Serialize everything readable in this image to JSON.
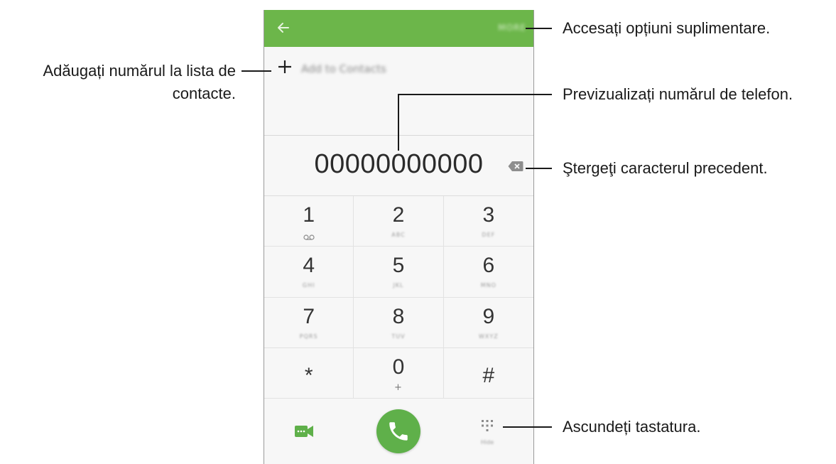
{
  "dialer": {
    "more_label": "MORE",
    "add_contact_label": "Add to Contacts",
    "phone_number": "00000000000",
    "keys": [
      {
        "digit": "1",
        "sub": ""
      },
      {
        "digit": "2",
        "sub": "ABC"
      },
      {
        "digit": "3",
        "sub": "DEF"
      },
      {
        "digit": "4",
        "sub": "GHI"
      },
      {
        "digit": "5",
        "sub": "JKL"
      },
      {
        "digit": "6",
        "sub": "MNO"
      },
      {
        "digit": "7",
        "sub": "PQRS"
      },
      {
        "digit": "8",
        "sub": "TUV"
      },
      {
        "digit": "9",
        "sub": "WXYZ"
      },
      {
        "digit": "*",
        "sub": ""
      },
      {
        "digit": "0",
        "sub": "+"
      },
      {
        "digit": "#",
        "sub": ""
      }
    ],
    "hide_label": "Hide",
    "accent_color": "#6cb64a",
    "call_color": "#5fb04a"
  },
  "annotations": {
    "more_options": "Accesați opțiuni suplimentare.",
    "add_contact_line1": "Adăugați numărul la lista de",
    "add_contact_line2": "contacte.",
    "preview_number": "Previzualizați numărul de telefon.",
    "delete_char": "Ştergeţi caracterul precedent.",
    "hide_keypad": "Ascundeți tastatura."
  }
}
